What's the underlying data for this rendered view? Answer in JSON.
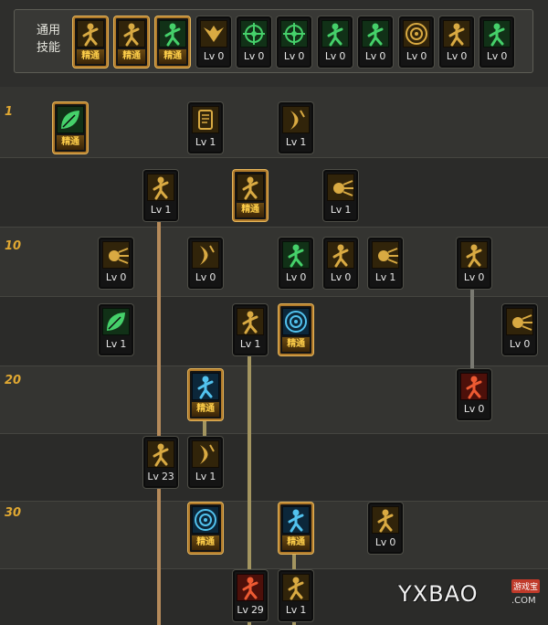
{
  "common": {
    "label_line1": "通用",
    "label_line2": "技能",
    "skills": [
      {
        "label": "精通",
        "master": true,
        "icon": "sitting-figure-icon",
        "theme": "gold"
      },
      {
        "label": "精通",
        "master": true,
        "icon": "crouching-figure-icon",
        "theme": "gold"
      },
      {
        "label": "精通",
        "master": true,
        "icon": "leaping-figure-icon",
        "theme": "green"
      },
      {
        "label": "Lv 0",
        "master": false,
        "icon": "wings-icon",
        "theme": "gold"
      },
      {
        "label": "Lv 0",
        "master": false,
        "icon": "crosshair-icon",
        "theme": "green"
      },
      {
        "label": "Lv 0",
        "master": false,
        "icon": "target-burst-icon",
        "theme": "green"
      },
      {
        "label": "Lv 0",
        "master": false,
        "icon": "dash-figure-icon",
        "theme": "green"
      },
      {
        "label": "Lv 0",
        "master": false,
        "icon": "crouch-strike-icon",
        "theme": "green"
      },
      {
        "label": "Lv 0",
        "master": false,
        "icon": "spiral-ring-icon",
        "theme": "gold"
      },
      {
        "label": "Lv 0",
        "master": false,
        "icon": "muscle-figure-icon",
        "theme": "gold"
      },
      {
        "label": "Lv 0",
        "master": false,
        "icon": "kick-figure-icon",
        "theme": "green"
      }
    ]
  },
  "level_markers": [
    "1",
    "10",
    "20",
    "30"
  ],
  "tree": [
    {
      "label": "精通",
      "master": true,
      "icon": "green-swirl-icon",
      "theme": "green"
    },
    {
      "label": "Lv 1",
      "master": false,
      "icon": "scroll-icon",
      "theme": "gold"
    },
    {
      "label": "Lv 1",
      "master": false,
      "icon": "claw-slash-icon",
      "theme": "gold"
    },
    {
      "label": "Lv 1",
      "master": false,
      "icon": "spin-kick-icon",
      "theme": "gold"
    },
    {
      "label": "精通",
      "master": true,
      "icon": "meditating-figure-icon",
      "theme": "gold"
    },
    {
      "label": "Lv 1",
      "master": false,
      "icon": "ground-burst-icon",
      "theme": "gold"
    },
    {
      "label": "Lv 0",
      "master": false,
      "icon": "scatter-sparks-icon",
      "theme": "gold"
    },
    {
      "label": "Lv 0",
      "master": false,
      "icon": "crescent-icon",
      "theme": "gold"
    },
    {
      "label": "Lv 0",
      "master": false,
      "icon": "armored-figure-icon",
      "theme": "green"
    },
    {
      "label": "Lv 0",
      "master": false,
      "icon": "throw-figure-icon",
      "theme": "gold"
    },
    {
      "label": "Lv 1",
      "master": false,
      "icon": "shatter-icon",
      "theme": "gold"
    },
    {
      "label": "Lv 0",
      "master": false,
      "icon": "punch-figure-icon",
      "theme": "gold"
    },
    {
      "label": "Lv 1",
      "master": false,
      "icon": "green-leaf-icon",
      "theme": "green"
    },
    {
      "label": "Lv 1",
      "master": false,
      "icon": "fist-rush-icon",
      "theme": "gold"
    },
    {
      "label": "精通",
      "master": true,
      "icon": "blue-vortex-icon",
      "theme": "blue"
    },
    {
      "label": "Lv 0",
      "master": false,
      "icon": "fireball-icon",
      "theme": "gold"
    },
    {
      "label": "精通",
      "master": true,
      "icon": "blue-aura-figure-icon",
      "theme": "blue"
    },
    {
      "label": "Lv 0",
      "master": false,
      "icon": "red-strike-icon",
      "theme": "red"
    },
    {
      "label": "Lv 23",
      "master": false,
      "icon": "twisting-figure-icon",
      "theme": "gold"
    },
    {
      "label": "Lv 1",
      "master": false,
      "icon": "slash-marks-icon",
      "theme": "gold"
    },
    {
      "label": "精通",
      "master": true,
      "icon": "blue-starburst-icon",
      "theme": "blue"
    },
    {
      "label": "精通",
      "master": true,
      "icon": "blue-warrior-icon",
      "theme": "blue"
    },
    {
      "label": "Lv 0",
      "master": false,
      "icon": "sliding-kick-icon",
      "theme": "gold"
    },
    {
      "label": "Lv 29",
      "master": false,
      "icon": "red-fist-icon",
      "theme": "red"
    },
    {
      "label": "Lv 1",
      "master": false,
      "icon": "coiled-figure-icon",
      "theme": "gold"
    }
  ],
  "watermark": {
    "text": "YXBAO",
    "badge": "游戏宝",
    "suffix": ".COM"
  },
  "colors": {
    "level_text": "#e0a832",
    "master_label": "#ffcf4a",
    "gold_art": "#c9a040",
    "green_art": "#3fc460",
    "blue_art": "#48b8e8",
    "red_art": "#d84a2a",
    "connector_orange": "#b58a5a",
    "connector_olive": "#a39560",
    "connector_gray": "#7a7a72"
  }
}
